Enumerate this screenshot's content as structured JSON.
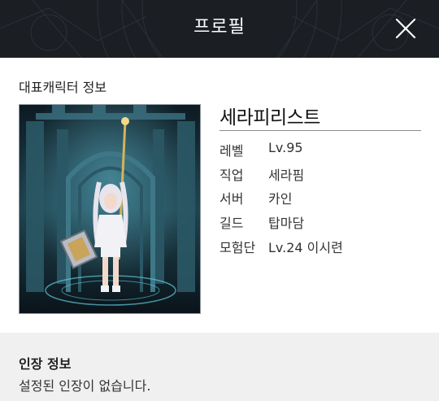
{
  "header": {
    "title": "프로필"
  },
  "main": {
    "section_label": "대표캐릭터 정보",
    "character": {
      "name": "세라피리스트",
      "fields": [
        {
          "label": "레벨",
          "value": "Lv.95"
        },
        {
          "label": "직업",
          "value": "세라핌"
        },
        {
          "label": "서버",
          "value": "카인"
        },
        {
          "label": "길드",
          "value": "탑마담"
        },
        {
          "label": "모험단",
          "value": "Lv.24 이시련"
        }
      ]
    }
  },
  "stamp": {
    "title": "인장 정보",
    "message": "설정된 인장이 없습니다."
  }
}
